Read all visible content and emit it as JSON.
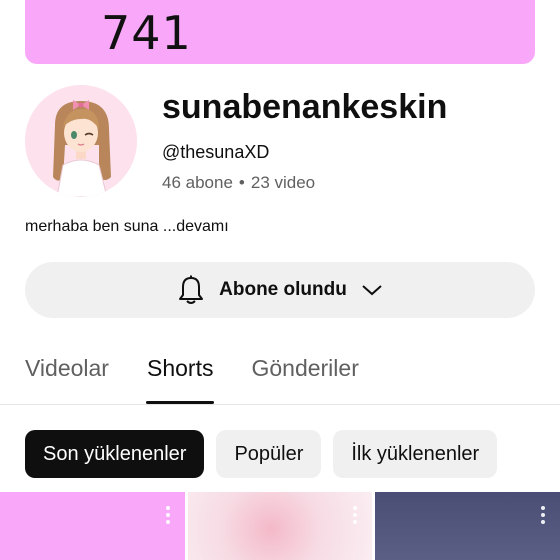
{
  "banner": {
    "text": "741",
    "color": "#f9a8f9"
  },
  "channel": {
    "name": "sunabenankeskin",
    "handle": "@thesunaXD",
    "subscribers": "46 abone",
    "separator": "•",
    "videos": "23 video"
  },
  "description": {
    "text": "merhaba ben suna ",
    "more": "...devamı"
  },
  "subscribe_button": {
    "label": "Abone olundu",
    "icon": "bell-icon",
    "dropdown_icon": "chevron-down-icon"
  },
  "tabs": [
    {
      "label": "Videolar",
      "active": false
    },
    {
      "label": "Shorts",
      "active": true
    },
    {
      "label": "Gönderiler",
      "active": false
    }
  ],
  "chips": [
    {
      "label": "Son yüklenenler",
      "active": true
    },
    {
      "label": "Popüler",
      "active": false
    },
    {
      "label": "İlk yüklenenler",
      "active": false
    }
  ],
  "thumbnails": [
    {
      "color": "#f9a8f9",
      "icon": "more-vert-icon"
    },
    {
      "color": "#f6d3de",
      "icon": "more-vert-icon"
    },
    {
      "color": "#55587e",
      "icon": "more-vert-icon"
    }
  ],
  "colors": {
    "accent": "#0f0f0f",
    "chip_bg": "#f0f0f0",
    "muted_text": "#606060"
  }
}
